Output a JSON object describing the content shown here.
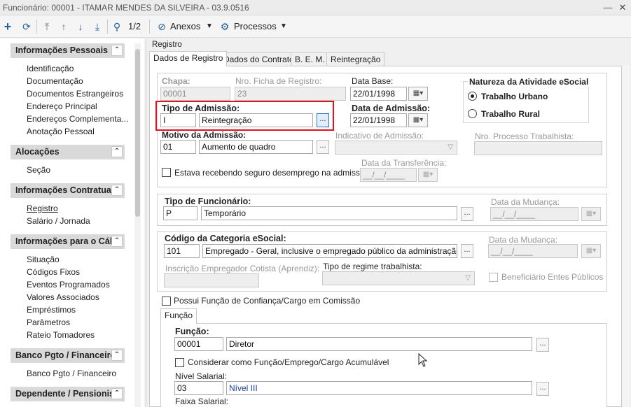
{
  "window": {
    "title": "Funcionário: 00001 - ITAMAR MENDES DA SILVEIRA - 03.9.0516",
    "min_label": "—",
    "close_label": "✕"
  },
  "toolbar": {
    "add_icon": "plus-icon",
    "refresh_icon": "refresh-icon",
    "page_counter": "1/2",
    "anexos_label": "Anexos",
    "processos_label": "Processos"
  },
  "sidebar": {
    "sections": [
      {
        "title": "Informações Pessoais",
        "items": [
          "Identificação",
          "Documentação",
          "Documentos Estrangeiros",
          "Endereço Principal",
          "Endereços Complementa...",
          "Anotação Pessoal"
        ]
      },
      {
        "title": "Alocações",
        "items": [
          "Seção"
        ]
      },
      {
        "title": "Informações Contratua",
        "items": [
          "Registro",
          "Salário / Jornada"
        ]
      },
      {
        "title": "Informações para o Cál",
        "items": [
          "Situação",
          "Códigos Fixos",
          "Eventos Programados",
          "Valores Associados",
          "Empréstimos",
          "Parâmetros",
          "Rateio Tomadores"
        ]
      },
      {
        "title": "Banco Pgto / Financeiro",
        "items": [
          "Banco Pgto / Financeiro"
        ]
      },
      {
        "title": "Dependente / Pensionis",
        "items": []
      }
    ]
  },
  "registro": {
    "group_title": "Registro",
    "tabs": [
      "Dados de Registro",
      "Dados do Contrato",
      "B. E. M.",
      "Reintegração"
    ],
    "chapa": {
      "label": "Chapa:",
      "value": "00001"
    },
    "nro_ficha": {
      "label": "Nro. Ficha de Registro:",
      "value": "23"
    },
    "data_base": {
      "label": "Data Base:",
      "value": "22/01/1998"
    },
    "natureza": {
      "title": "Natureza da Atividade eSocial",
      "opt1": "Trabalho Urbano",
      "opt2": "Trabalho Rural"
    },
    "tipo_admissao": {
      "label": "Tipo de Admissão:",
      "code": "I",
      "desc": "Reintegração"
    },
    "data_admissao": {
      "label": "Data de Admissão:",
      "value": "22/01/1998"
    },
    "motivo": {
      "label": "Motivo da Admissão:",
      "code": "01",
      "desc": "Aumento de quadro"
    },
    "indicativo": {
      "label": "Indicativo de Admissão:"
    },
    "nro_processo": {
      "label": "Nro. Processo Trabalhista:"
    },
    "seguro": {
      "label": "Estava recebendo seguro desemprego na admissão"
    },
    "data_transf": {
      "label": "Data da Transferência:",
      "value": "__/__/____"
    },
    "tipo_func": {
      "label": "Tipo de Funcionário:",
      "code": "P",
      "desc": "Temporário"
    },
    "data_mudanca1": {
      "label": "Data da Mudança:",
      "value": "__/__/____"
    },
    "categoria": {
      "label": "Código da Categoria eSocial:",
      "code": "101",
      "desc": "Empregado - Geral, inclusive o empregado público da administração direta o"
    },
    "data_mudanca2": {
      "label": "Data da Mudança:",
      "value": "__/__/____"
    },
    "inscricao": {
      "label": "Inscrição Empregador Cotista (Aprendiz):"
    },
    "regime": {
      "label": "Tipo de regime trabalhista:"
    },
    "beneficiario": {
      "label": "Beneficiário Entes Públicos"
    },
    "possui_funcao": {
      "label": "Possui Função de Confiança/Cargo em Comissão"
    },
    "funcao_tab": "Função",
    "funcao": {
      "label": "Função:",
      "code": "00001",
      "desc": "Diretor"
    },
    "considerar": {
      "label": "Considerar como Função/Emprego/Cargo Acumulável"
    },
    "nivel": {
      "label": "Nível Salarial:",
      "code": "03",
      "desc": "Nível III"
    },
    "faixa": {
      "label": "Faixa Salarial:"
    },
    "dots_label": "...",
    "cal_label": "▦▾"
  },
  "colors": {
    "accent": "#1e5f9e",
    "highlight": "#e0141e"
  }
}
